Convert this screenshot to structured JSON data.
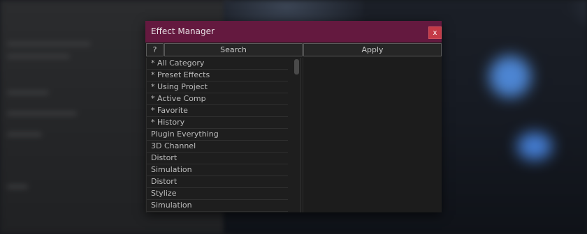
{
  "window": {
    "title": "Effect Manager",
    "close_label": "x"
  },
  "toolbar": {
    "help_label": "?",
    "search_label": "Search",
    "apply_label": "Apply"
  },
  "categories": [
    "* All Category",
    "* Preset Effects",
    "* Using Project",
    "* Active Comp",
    "* Favorite",
    "* History",
    "Plugin Everything",
    "3D Channel",
    "Distort",
    "Simulation",
    "Distort",
    "Stylize",
    "Simulation"
  ],
  "colors": {
    "titlebar": "#64193f",
    "close_button": "#c43a47",
    "panel_bg": "#1e1e1e"
  }
}
